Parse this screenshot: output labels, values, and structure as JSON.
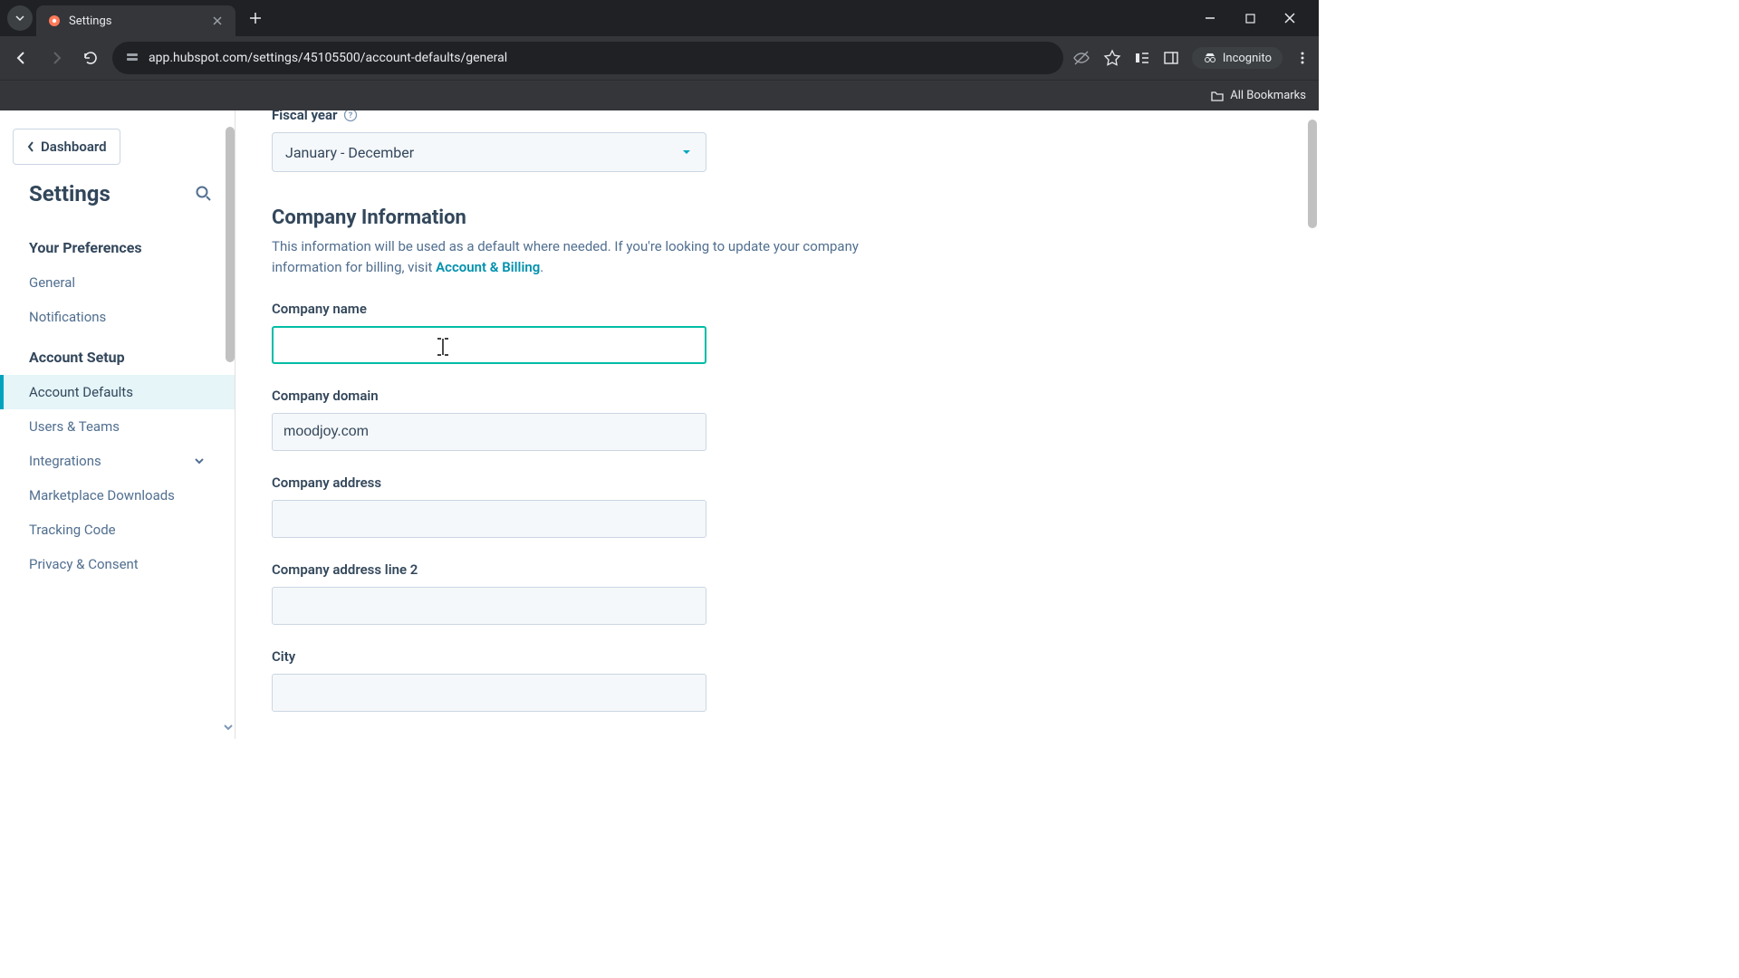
{
  "browser": {
    "tab_title": "Settings",
    "url": "app.hubspot.com/settings/45105500/account-defaults/general",
    "incognito_label": "Incognito",
    "all_bookmarks": "All Bookmarks"
  },
  "sidebar": {
    "dashboard_label": "Dashboard",
    "settings_title": "Settings",
    "preferences_label": "Your Preferences",
    "pref_items": [
      "General",
      "Notifications"
    ],
    "account_setup_label": "Account Setup",
    "setup_items": [
      {
        "label": "Account Defaults",
        "active": true,
        "expandable": false
      },
      {
        "label": "Users & Teams",
        "active": false,
        "expandable": false
      },
      {
        "label": "Integrations",
        "active": false,
        "expandable": true
      },
      {
        "label": "Marketplace Downloads",
        "active": false,
        "expandable": false
      },
      {
        "label": "Tracking Code",
        "active": false,
        "expandable": false
      },
      {
        "label": "Privacy & Consent",
        "active": false,
        "expandable": false
      }
    ]
  },
  "form": {
    "fiscal_year_label": "Fiscal year",
    "fiscal_year_value": "January - December",
    "company_info_heading": "Company Information",
    "company_info_desc_prefix": "This information will be used as a default where needed. If you're looking to update your company information for billing, visit ",
    "account_billing_link": "Account & Billing",
    "company_info_desc_suffix": ".",
    "fields": {
      "company_name": {
        "label": "Company name",
        "value": ""
      },
      "company_domain": {
        "label": "Company domain",
        "value": "moodjoy.com"
      },
      "company_address": {
        "label": "Company address",
        "value": ""
      },
      "company_address_2": {
        "label": "Company address line 2",
        "value": ""
      },
      "city": {
        "label": "City",
        "value": ""
      }
    }
  }
}
